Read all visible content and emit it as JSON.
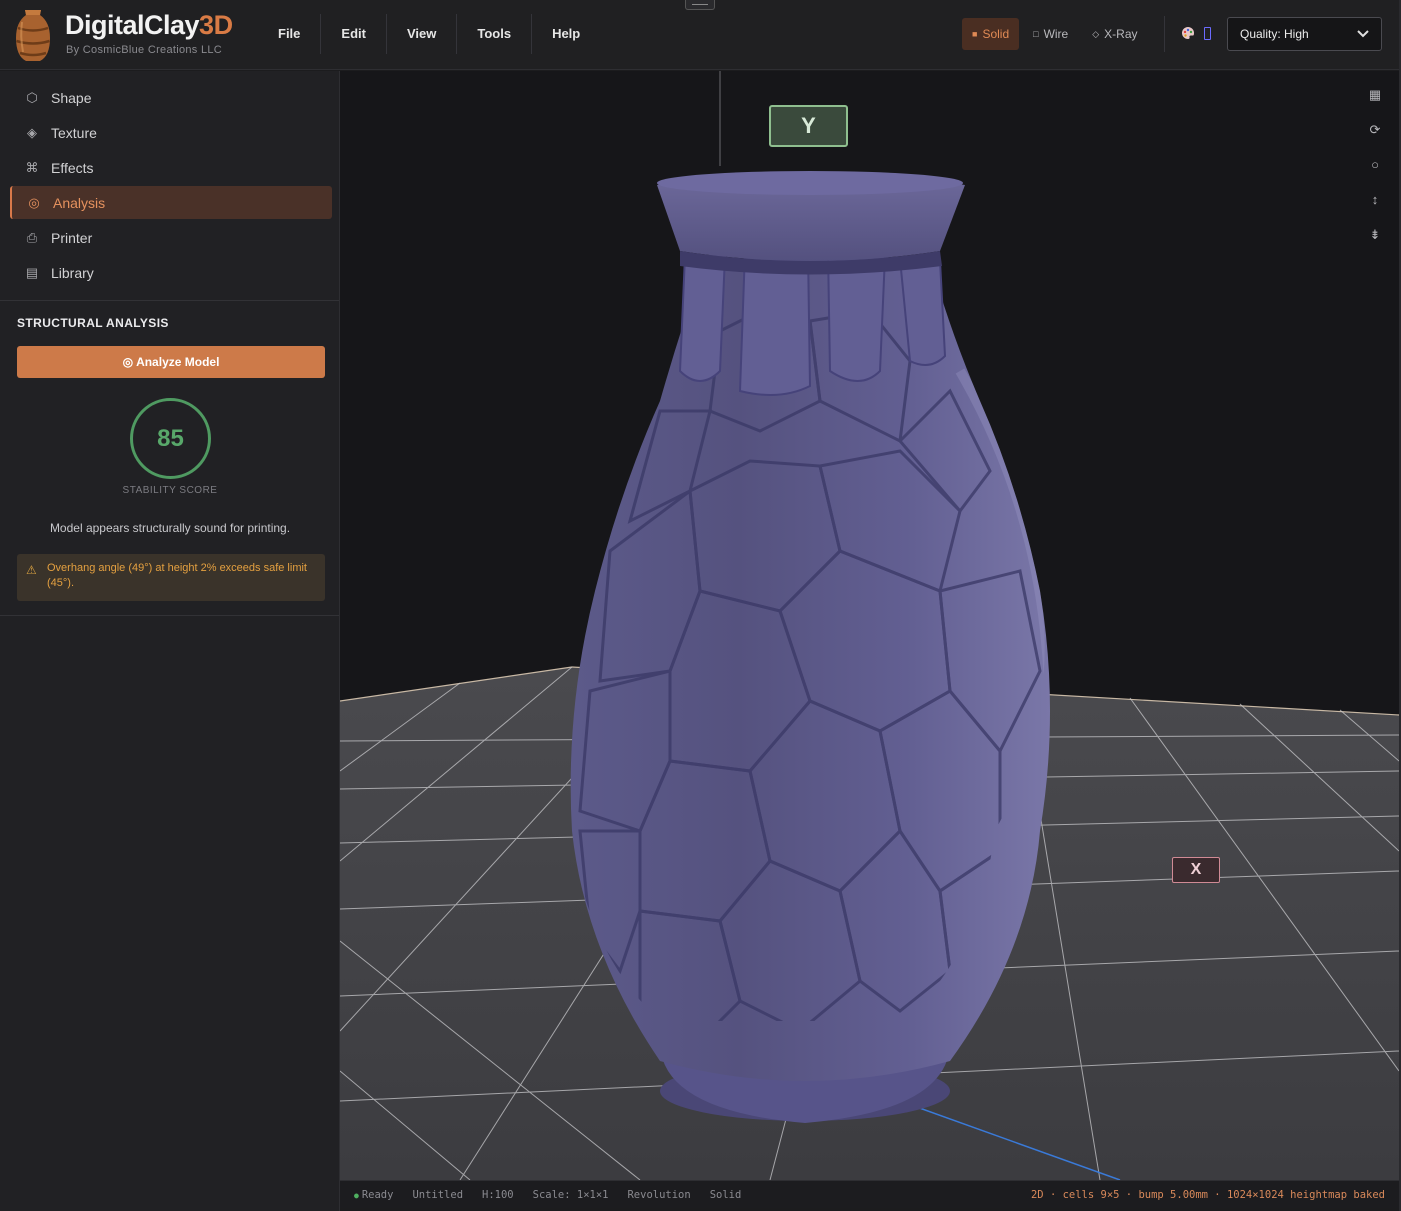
{
  "app": {
    "name_main": "DigitalClay",
    "name_accent": "3D",
    "subtitle": "By CosmicBlue Creations LLC"
  },
  "menu": [
    "File",
    "Edit",
    "View",
    "Tools",
    "Help"
  ],
  "view_modes": [
    {
      "label": "Solid",
      "glyph": "■",
      "active": true
    },
    {
      "label": "Wire",
      "glyph": "□",
      "active": false
    },
    {
      "label": "X-Ray",
      "glyph": "◇",
      "active": false
    }
  ],
  "quality": {
    "value": "Quality: High"
  },
  "sidebar": {
    "items": [
      {
        "label": "Shape",
        "icon": "hexagon-icon",
        "glyph": "⬡",
        "active": false
      },
      {
        "label": "Texture",
        "icon": "diamond-icon",
        "glyph": "◈",
        "active": false
      },
      {
        "label": "Effects",
        "icon": "command-icon",
        "glyph": "⌘",
        "active": false
      },
      {
        "label": "Analysis",
        "icon": "target-icon",
        "glyph": "◎",
        "active": true
      },
      {
        "label": "Printer",
        "icon": "printer-icon",
        "glyph": "⎙",
        "active": false
      },
      {
        "label": "Library",
        "icon": "library-icon",
        "glyph": "▤",
        "active": false
      }
    ]
  },
  "analysis": {
    "title": "STRUCTURAL ANALYSIS",
    "button_glyph": "◎",
    "button_label": "Analyze Model",
    "score": "85",
    "score_label": "STABILITY SCORE",
    "message": "Model appears structurally sound for printing.",
    "warning": "Overhang angle (49°) at height 2% exceeds safe limit (45°).",
    "warning_glyph": "⚠"
  },
  "viewport": {
    "axis_y": "Y",
    "axis_x": "X",
    "tools": [
      {
        "name": "grid-toggle-icon",
        "glyph": "▦"
      },
      {
        "name": "rotate-icon",
        "glyph": "⟳"
      },
      {
        "name": "sphere-icon",
        "glyph": "○"
      },
      {
        "name": "vertical-arrows-icon",
        "glyph": "↕"
      },
      {
        "name": "align-icon",
        "glyph": "⇟"
      }
    ]
  },
  "status": {
    "state": "Ready",
    "file": "Untitled",
    "height": "H:100",
    "scale": "Scale: 1×1×1",
    "mode": "Revolution",
    "render": "Solid",
    "right": "2D · cells 9×5 · bump 5.00mm · 1024×1024 heightmap baked"
  },
  "colors": {
    "accent": "#d97b45",
    "vase": "#5a5788",
    "grid": "#3c3c40",
    "score_ok": "#4f9a61",
    "warning": "#e4a040"
  }
}
